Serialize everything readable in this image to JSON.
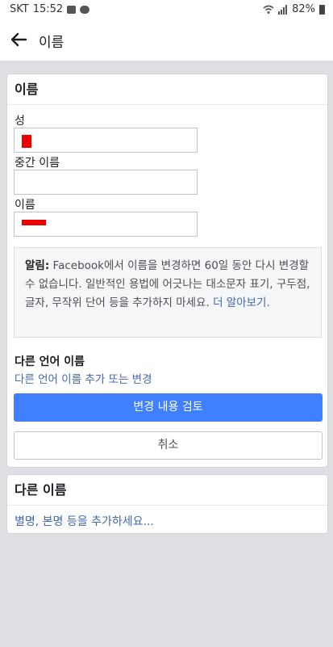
{
  "status_bar": {
    "carrier": "SKT",
    "time": "15:52",
    "battery": "82%",
    "icons": [
      "image-icon",
      "chat-icon",
      "wifi-icon",
      "signal-icon",
      "battery-icon"
    ]
  },
  "app_bar": {
    "title": "이름",
    "back_icon": "arrow-left-icon"
  },
  "name_card": {
    "header": "이름",
    "fields": [
      {
        "label": "성",
        "value": ""
      },
      {
        "label": "중간 이름",
        "value": ""
      },
      {
        "label": "이름",
        "value": ""
      }
    ],
    "notice": {
      "bold": "알림:",
      "text": " Facebook에서 이름을 변경하면 60일 동안 다시 변경할 수 없습니다. 일반적인 용법에 어긋나는 대소문자 표기, 구두점, 글자, 무작위 단어 등을 추가하지 마세요. ",
      "link": "더 알아보기."
    },
    "other_language": {
      "title": "다른 언어 이름",
      "link": "다른 언어 이름 추가 또는 변경"
    },
    "review_button": "변경 내용 검토",
    "cancel_button": "취소"
  },
  "other_names_card": {
    "header": "다른 이름",
    "link": "별명, 본명 등을 추가하세요..."
  },
  "colors": {
    "primary": "#4080ff",
    "link": "#4267b2",
    "redaction": "#ee0000",
    "page_bg": "#dddfe2"
  }
}
